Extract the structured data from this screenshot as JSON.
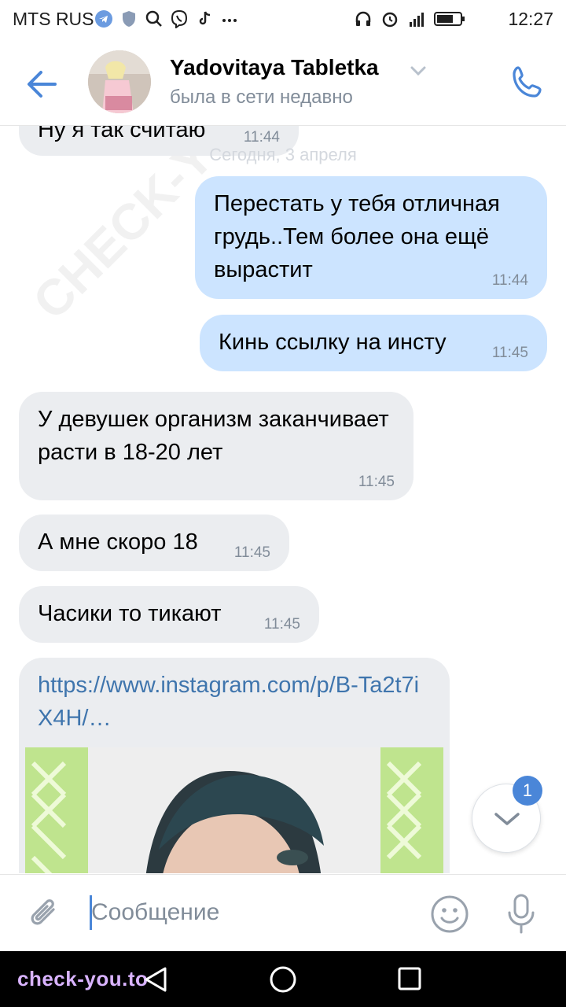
{
  "status_bar": {
    "carrier": "MTS RUS",
    "time": "12:27"
  },
  "header": {
    "contact_name": "Yadovitaya Tabletka",
    "contact_status": "была в сети недавно"
  },
  "chat": {
    "date_separator": "Сегодня, 3 апреля",
    "messages": [
      {
        "text": "Ну я так считаю",
        "time": "11:44"
      },
      {
        "text": "Перестать у тебя отличная грудь..Тем более она ещё вырастит",
        "time": "11:44"
      },
      {
        "text": "Кинь ссылку на инсту",
        "time": "11:45"
      },
      {
        "text": "У девушек организм заканчивает расти в 18-20 лет",
        "time": "11:45"
      },
      {
        "text": "А мне скоро 18",
        "time": "11:45"
      },
      {
        "text": "Часики то тикают",
        "time": "11:45"
      }
    ],
    "link": "https://www.instagram.com/p/B-Ta2t7iX4H/…"
  },
  "scroll_down": {
    "unread_count": "1"
  },
  "composer": {
    "placeholder": "Сообщение"
  },
  "watermark": {
    "text": "check-you.to",
    "diagonal": "CHECK-YOU.ME"
  },
  "colors": {
    "accent": "#4a86d8",
    "incoming_bubble": "#ebedf0",
    "outgoing_bubble": "#cce4ff",
    "link": "#3f75ad",
    "secondary_text": "#818c99"
  },
  "icons": {
    "back": "arrow-left-icon",
    "call": "phone-icon",
    "attach": "paperclip-icon",
    "emoji": "smile-icon",
    "mic": "microphone-icon",
    "scroll": "chevron-down-icon"
  }
}
